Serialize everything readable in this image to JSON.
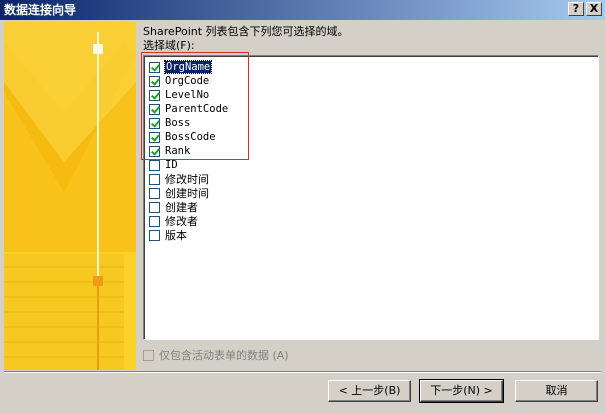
{
  "window": {
    "title": "数据连接向导",
    "help_label": "?",
    "close_label": "X"
  },
  "desc": "SharePoint 列表包含下列您可选择的域。",
  "fields_label": "选择域(F):",
  "fields": [
    {
      "label": "OrgName",
      "checked": true,
      "selected": true
    },
    {
      "label": "OrgCode",
      "checked": true
    },
    {
      "label": "LevelNo",
      "checked": true
    },
    {
      "label": "ParentCode",
      "checked": true
    },
    {
      "label": "Boss",
      "checked": true
    },
    {
      "label": "BossCode",
      "checked": true
    },
    {
      "label": "Rank",
      "checked": true
    },
    {
      "label": "ID",
      "checked": false
    },
    {
      "label": "修改时间",
      "checked": false
    },
    {
      "label": "创建时间",
      "checked": false
    },
    {
      "label": "创建者",
      "checked": false
    },
    {
      "label": "修改者",
      "checked": false
    },
    {
      "label": "版本",
      "checked": false
    }
  ],
  "only_active": {
    "label": "仅包含活动表单的数据 (A)",
    "checked": false,
    "enabled": false
  },
  "buttons": {
    "back": "< 上一步(B)",
    "next": "下一步(N) >",
    "cancel": "取消"
  },
  "colors": {
    "title_start": "#0a246a",
    "banner": "#fbd22a",
    "highlight": "#e0282d",
    "check": "#21a121"
  }
}
